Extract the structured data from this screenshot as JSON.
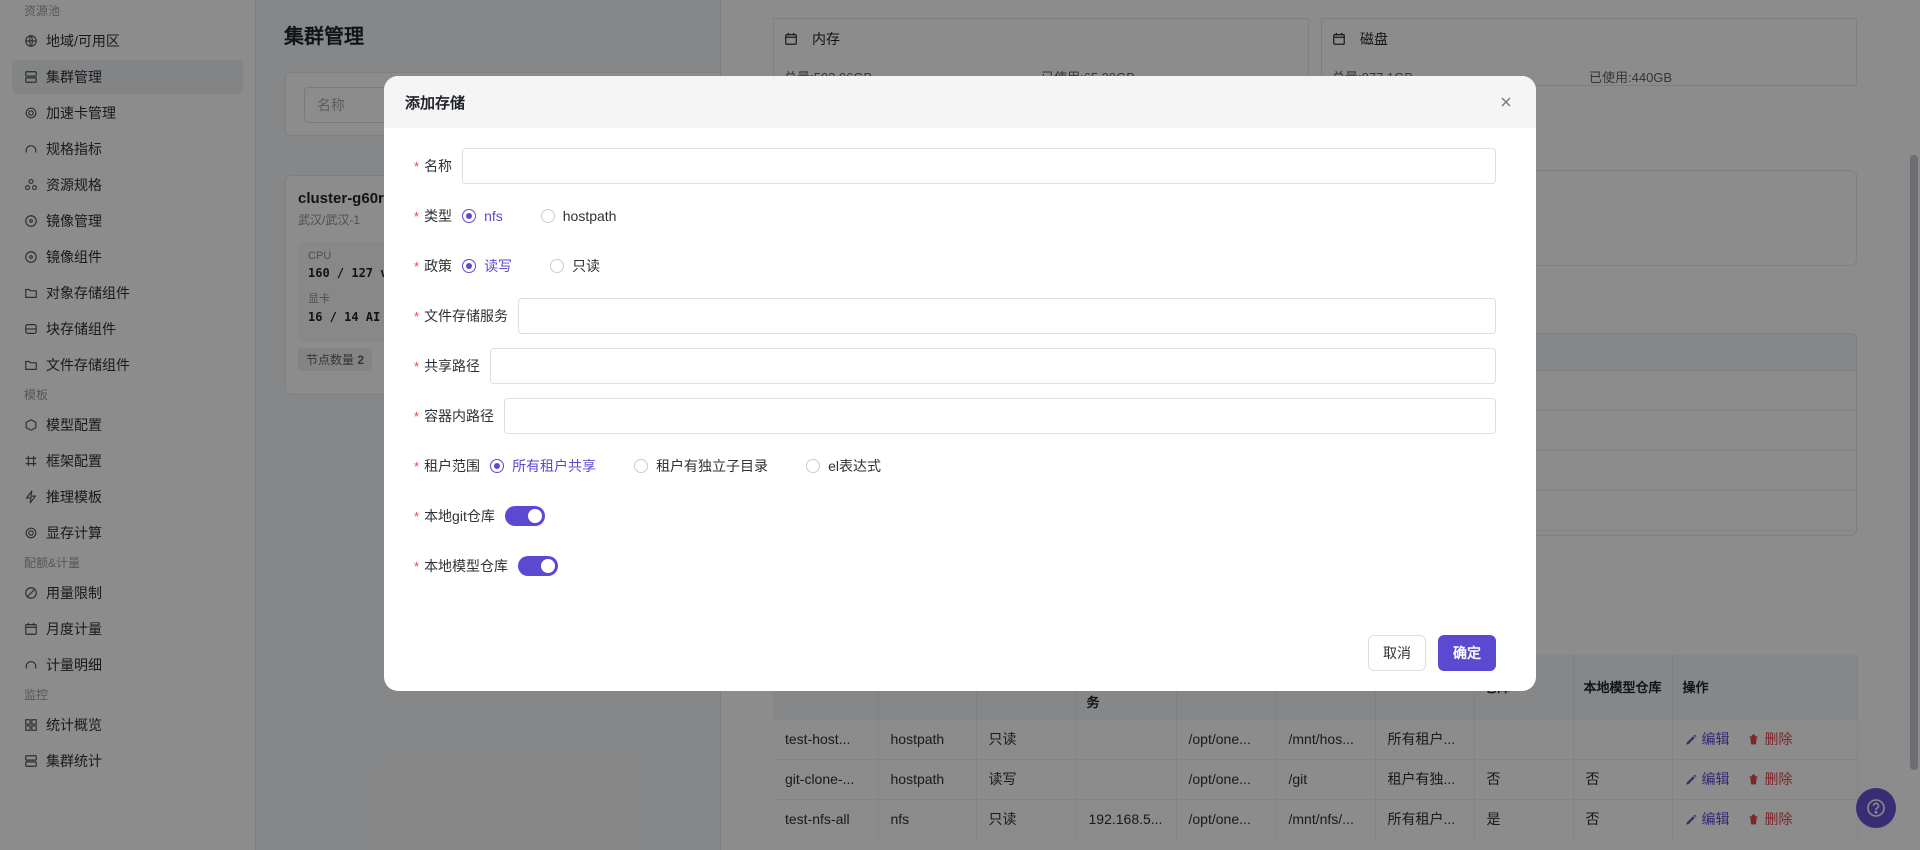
{
  "sidebar": {
    "groups": [
      {
        "label": "资源池",
        "items": [
          {
            "label": "地域/可用区",
            "icon": "globe-icon"
          },
          {
            "label": "集群管理",
            "icon": "server-icon",
            "active": true
          },
          {
            "label": "加速卡管理",
            "icon": "gear-icon"
          },
          {
            "label": "规格指标",
            "icon": "gauge-icon"
          },
          {
            "label": "资源规格",
            "icon": "cluster-icon"
          },
          {
            "label": "镜像管理",
            "icon": "disc-icon"
          },
          {
            "label": "镜像组件",
            "icon": "disc-icon"
          },
          {
            "label": "对象存储组件",
            "icon": "folder-icon"
          },
          {
            "label": "块存储组件",
            "icon": "storage-icon"
          },
          {
            "label": "文件存储组件",
            "icon": "folder-icon"
          }
        ]
      },
      {
        "label": "模板",
        "items": [
          {
            "label": "模型配置",
            "icon": "cube-icon"
          },
          {
            "label": "框架配置",
            "icon": "hash-icon"
          },
          {
            "label": "推理模板",
            "icon": "bolt-icon"
          },
          {
            "label": "显存计算",
            "icon": "gear-icon"
          }
        ]
      },
      {
        "label": "配额&计量",
        "items": [
          {
            "label": "用量限制",
            "icon": "limit-icon"
          },
          {
            "label": "月度计量",
            "icon": "calendar-icon"
          },
          {
            "label": "计量明细",
            "icon": "gauge-icon"
          }
        ]
      },
      {
        "label": "监控",
        "items": [
          {
            "label": "统计概览",
            "icon": "grid-icon"
          },
          {
            "label": "集群统计",
            "icon": "server-icon"
          }
        ]
      }
    ]
  },
  "main": {
    "title": "集群管理",
    "name_placeholder": "名称",
    "cluster": {
      "name": "cluster-g60r",
      "region": "武汉/武汉-1",
      "cpu_label": "CPU",
      "cpu_value": "160 / 127 v",
      "gpu_label": "显卡",
      "gpu_value": "16 / 14 AI",
      "nodes_label": "节点数量",
      "nodes_value": "2"
    }
  },
  "drawer": {
    "memory": {
      "title": "内存",
      "total": "总量:503.06GB",
      "used": "已使用:65.29GB"
    },
    "disk": {
      "title": "磁盘",
      "total": "总量:877.1GB",
      "used": "已使用:440GB"
    },
    "table": {
      "headers": [
        "",
        "",
        "",
        "务",
        "",
        "",
        "",
        "仓库",
        "本地模型仓库",
        "操作"
      ],
      "rows": [
        [
          "test-host...",
          "hostpath",
          "只读",
          "",
          "/opt/one...",
          "/mnt/hos...",
          "所有租户...",
          "",
          ""
        ],
        [
          "git-clone-...",
          "hostpath",
          "读写",
          "",
          "/opt/one...",
          "/git",
          "租户有独...",
          "否",
          "否"
        ],
        [
          "test-nfs-all",
          "nfs",
          "只读",
          "192.168.5...",
          "/opt/one...",
          "/mnt/nfs/...",
          "所有租户...",
          "是",
          "否"
        ]
      ],
      "edit_label": "编辑",
      "delete_label": "删除"
    }
  },
  "modal": {
    "title": "添加存储",
    "fields": {
      "name": "名称",
      "type": "类型",
      "policy": "政策",
      "file_service": "文件存储服务",
      "share_path": "共享路径",
      "container_path": "容器内路径",
      "tenant_scope": "租户范围",
      "local_git": "本地git仓库",
      "local_model": "本地模型仓库"
    },
    "type_options": [
      "nfs",
      "hostpath"
    ],
    "type_selected": "nfs",
    "policy_options": [
      "读写",
      "只读"
    ],
    "policy_selected": "读写",
    "tenant_options": [
      "所有租户共享",
      "租户有独立子目录",
      "el表达式"
    ],
    "tenant_selected": "所有租户共享",
    "local_git_on": true,
    "local_model_on": true,
    "cancel_label": "取消",
    "ok_label": "确定"
  },
  "colors": {
    "accent": "#5b4ad1",
    "danger": "#e5484d"
  }
}
